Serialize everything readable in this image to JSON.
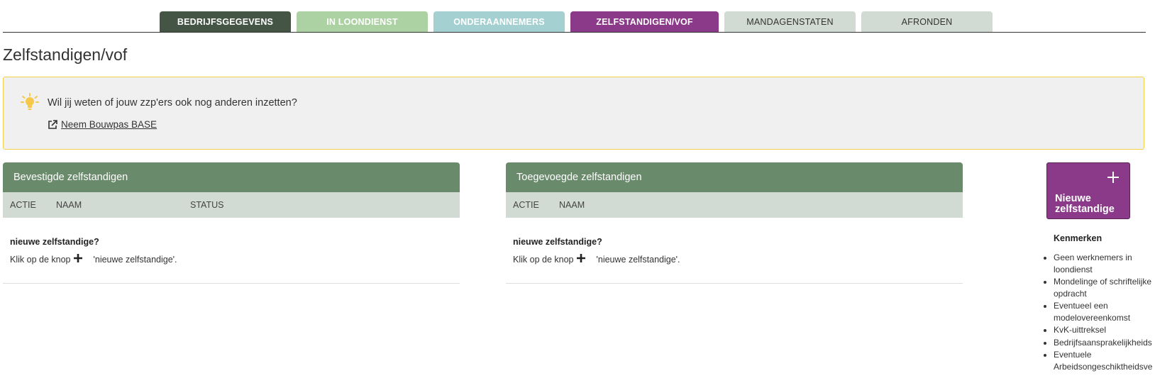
{
  "tabs": [
    {
      "label": "BEDRIJFSGEGEVENS",
      "state": "done",
      "color": "#445545"
    },
    {
      "label": "IN LOONDIENST",
      "state": "done",
      "color": "#acd2a4"
    },
    {
      "label": "ONDERAANNEMERS",
      "state": "done",
      "color": "#a5d0d2"
    },
    {
      "label": "ZELFSTANDIGEN/VOF",
      "state": "active",
      "color": "#8a3a88"
    },
    {
      "label": "MANDAGENSTATEN",
      "state": "todo",
      "color": "#d2dbd3"
    },
    {
      "label": "AFRONDEN",
      "state": "todo",
      "color": "#d2dbd3"
    }
  ],
  "page": {
    "title": "Zelfstandigen/vof"
  },
  "info": {
    "icon": "lightbulb-icon",
    "text": "Wil jij weten of jouw zzp'ers ook nog anderen inzetten?",
    "link_icon": "external-link-icon",
    "link_label": "Neem Bouwpas BASE"
  },
  "confirmed_panel": {
    "title": "Bevestigde zelfstandigen",
    "columns": [
      "ACTIE",
      "NAAM",
      "STATUS"
    ],
    "empty_title": "nieuwe zelfstandige?",
    "empty_prefix": "Klik op de knop",
    "empty_suffix": "'nieuwe zelfstandige'."
  },
  "added_panel": {
    "title": "Toegevoegde zelfstandigen",
    "columns": [
      "ACTIE",
      "NAAM"
    ],
    "empty_title": "nieuwe zelfstandige?",
    "empty_prefix": "Klik op de knop",
    "empty_suffix": "'nieuwe zelfstandige'."
  },
  "new_button": {
    "label": "Nieuwe zelfstandige",
    "icon": "plus-icon"
  },
  "kenmerken": {
    "title": "Kenmerken",
    "items": [
      "Geen werknemers in loondienst",
      "Mondelinge of schriftelijke opdracht",
      "Eventueel een modelovereenkomst",
      "KvK-uittreksel",
      "Bedrijfsaansprakelijkheids",
      "Eventuele Arbeidsongeschiktheidsve"
    ]
  },
  "colors": {
    "accent": "#8a3a88",
    "panel_header": "#6a8a6c",
    "column_bar": "#d2dbd3",
    "info_border": "#f5d04a"
  }
}
